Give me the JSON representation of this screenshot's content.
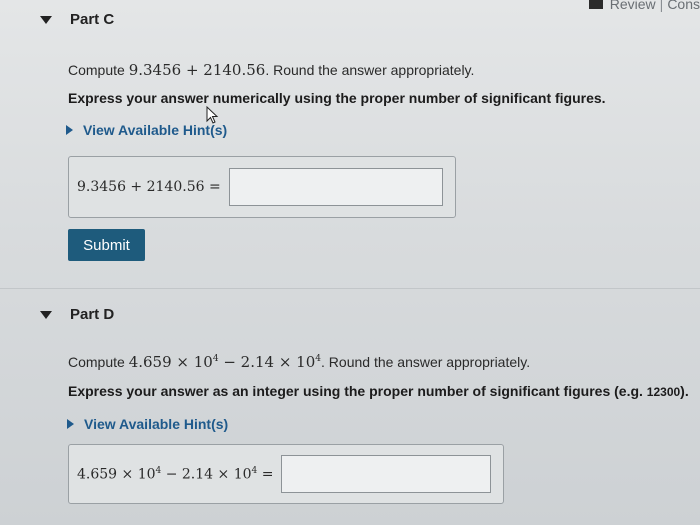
{
  "top_links": {
    "review": "Review",
    "separator": "|",
    "constants": "Cons"
  },
  "part_c": {
    "header": "Part C",
    "compute_prefix": "Compute",
    "expression": "9.3456 + 2140.56",
    "compute_suffix": ". Round the answer appropriately.",
    "instruction": "Express your answer numerically using the proper number of significant figures.",
    "hint_link": "View Available Hint(s)",
    "answer_label": "9.3456 + 2140.56 =",
    "answer_value": "",
    "submit_label": "Submit"
  },
  "part_d": {
    "header": "Part D",
    "compute_prefix": "Compute",
    "expr_a_mant": "4.659 × 10",
    "expr_a_exp": "4",
    "expr_mid": " − 2.14 × 10",
    "expr_b_exp": "4",
    "compute_suffix": ". Round the answer appropriately.",
    "instruction": "Express your answer as an integer using the proper number of significant figures (e.g.",
    "instruction_example": "12300",
    "instruction_end": ").",
    "hint_link": "View Available Hint(s)",
    "answer_a_mant": "4.659 × 10",
    "answer_a_exp": "4",
    "answer_mid": " − 2.14 × 10",
    "answer_b_exp": "4",
    "answer_eq": " =",
    "answer_value": ""
  }
}
